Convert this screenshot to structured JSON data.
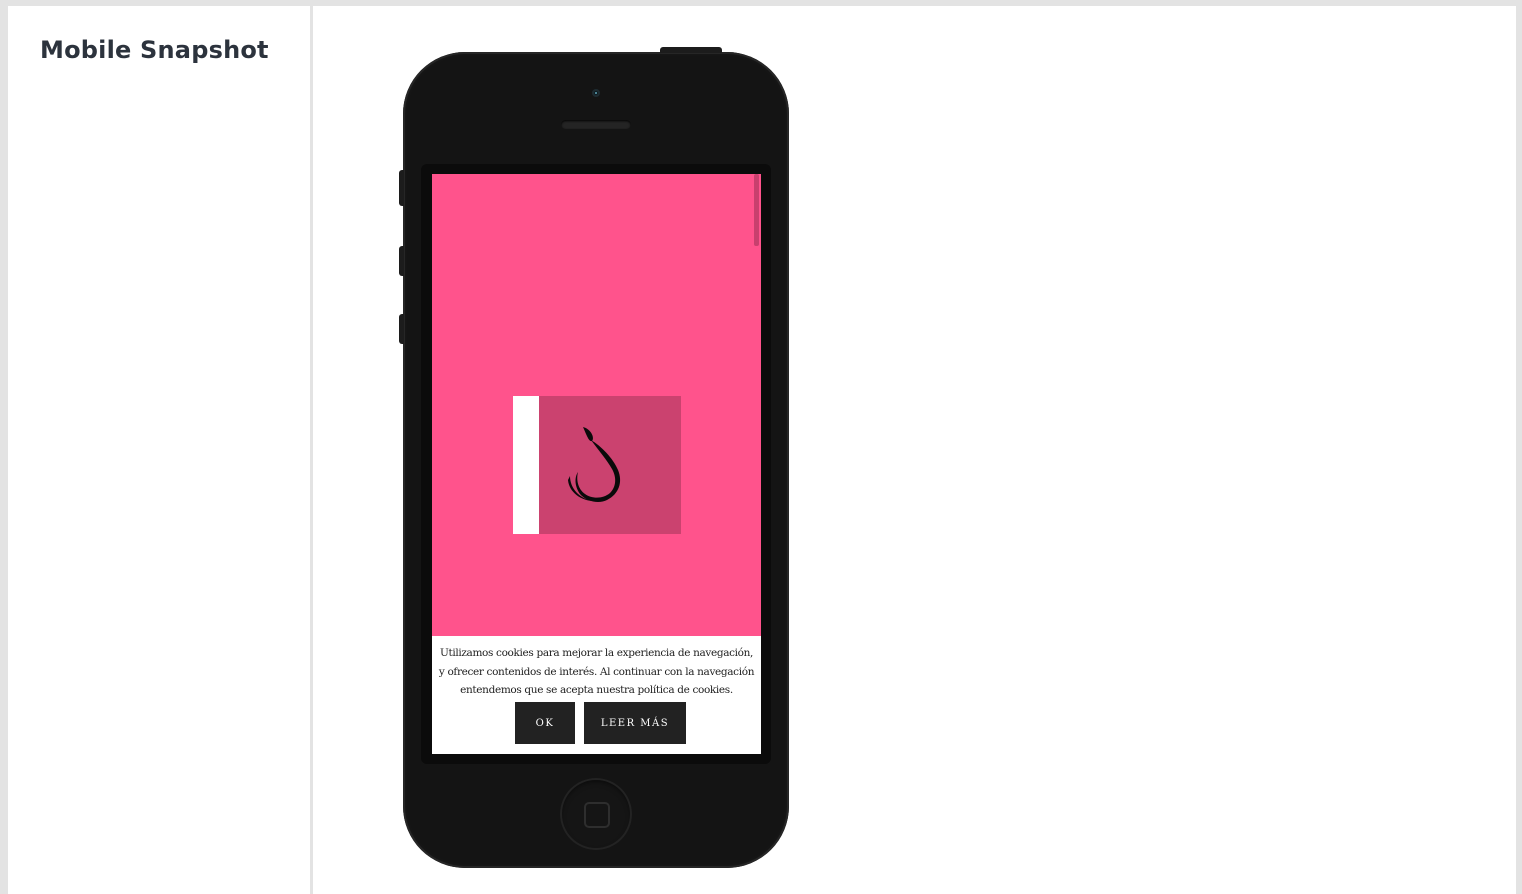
{
  "section": {
    "title": "Mobile Snapshot"
  },
  "screen": {
    "background_color": "#ff538c",
    "logo": {
      "icon": "drop-swirl-logo-icon",
      "box_color": "#cb426f",
      "stripe_color": "#ffffff"
    }
  },
  "cookie_banner": {
    "text": "Utilizamos cookies para mejorar la experiencia de navegación, y ofrecer contenidos de interés. Al continuar con la navegación entendemos que se acepta nuestra política de cookies.",
    "ok_label": "OK",
    "read_more_label": "LEER MÁS"
  },
  "phone": {
    "color": "#141414",
    "icons": [
      "camera-icon",
      "speaker-icon",
      "home-button-icon"
    ]
  }
}
